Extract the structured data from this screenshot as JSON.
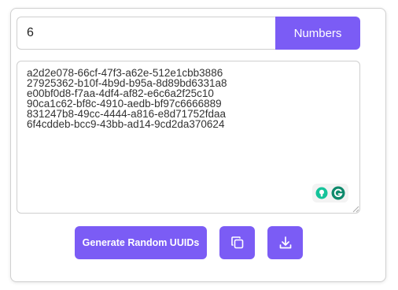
{
  "count_input": {
    "value": "6"
  },
  "numbers_button": {
    "label": "Numbers"
  },
  "output": {
    "text": "a2d2e078-66cf-47f3-a62e-512e1cbb3886\n27925362-b10f-4b9d-b95a-8d89bd6331a8\ne00bf0d8-f7aa-4df4-af82-e6c6a2f25c10\n90ca1c62-bf8c-4910-aedb-bf97c6666889\n831247b8-49cc-4444-a816-e8d71752fdaa\n6f4cddeb-bcc9-43bb-ad14-9cd2da370624"
  },
  "actions": {
    "generate_label": "Generate Random UUIDs",
    "copy_icon": "copy-icon",
    "download_icon": "download-icon"
  },
  "extension_badge": {
    "icons": [
      "lightbulb-icon",
      "grammarly-icon"
    ]
  },
  "colors": {
    "accent": "#7b5cf5",
    "border": "#cfcfcf",
    "grammarly_green": "#15c39a",
    "grammarly_dark": "#0e8a6c"
  }
}
